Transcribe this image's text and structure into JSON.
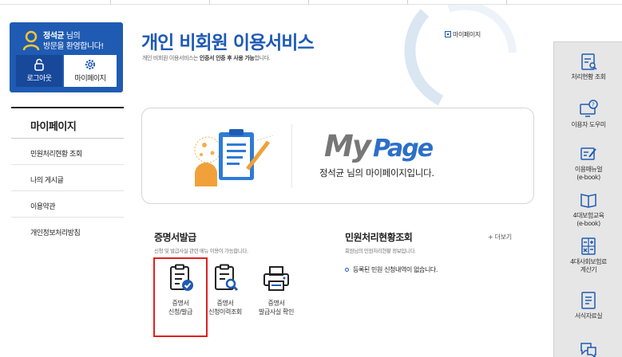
{
  "user": {
    "name": "정석균",
    "suffix": " 님의",
    "welcome": "방문을 환영합니다!",
    "logout_label": "로그아웃",
    "mypage_label": "마이페이지"
  },
  "sidebar": {
    "title": "마이페이지",
    "items": [
      {
        "label": "민원처리현황 조회"
      },
      {
        "label": "나의 게시글"
      },
      {
        "label": "이용약관"
      },
      {
        "label": "개인정보처리방침"
      }
    ]
  },
  "header": {
    "title": "개인 비회원 이용서비스",
    "subtitle_pre": "개인 비회원 이용서비스는 ",
    "subtitle_bold": "인증서 인증 후 사용 가능",
    "subtitle_post": "합니다.",
    "breadcrumb": "마이페이지"
  },
  "banner": {
    "logo_my": "My",
    "logo_page": "Page",
    "message": "정석균 님의 마이페이지입니다."
  },
  "certificate": {
    "title": "증명서발급",
    "subtitle": "신청 및 발급사실 관련 메뉴 이용이 가능합니다.",
    "items": [
      {
        "line1": "증명서",
        "line2": "신청/발급",
        "icon": "certificate-check-icon"
      },
      {
        "line1": "증명서",
        "line2": "신청이력조회",
        "icon": "document-search-icon"
      },
      {
        "line1": "증명서",
        "line2": "발급사실 확인",
        "icon": "printer-icon"
      }
    ]
  },
  "status": {
    "title": "민원처리현황조회",
    "subtitle": "회원님의 민원처리현황 정보입니다.",
    "more": "+ 더보기",
    "empty": "등록된 민원 신청내역이 없습니다."
  },
  "quickmenu": [
    {
      "label1": "처리현황 조회",
      "label2": "",
      "icon": "clipboard-search-icon"
    },
    {
      "label1": "이용자 도우미",
      "label2": "",
      "icon": "monitor-help-icon"
    },
    {
      "label1": "이용매뉴얼",
      "label2": "(e-book)",
      "icon": "edit-manual-icon"
    },
    {
      "label1": "4대보험교육",
      "label2": "(e-book)",
      "icon": "book-icon"
    },
    {
      "label1": "4대사회보험료",
      "label2": "계산기",
      "icon": "calculator-icon"
    },
    {
      "label1": "서식자료실",
      "label2": "",
      "icon": "document-list-icon"
    },
    {
      "label1": "",
      "label2": "",
      "icon": "chat-icon"
    }
  ],
  "colors": {
    "brand_blue": "#1f5bb3",
    "highlight_red": "#e0201b",
    "quick_bg": "#e6e6e6"
  }
}
